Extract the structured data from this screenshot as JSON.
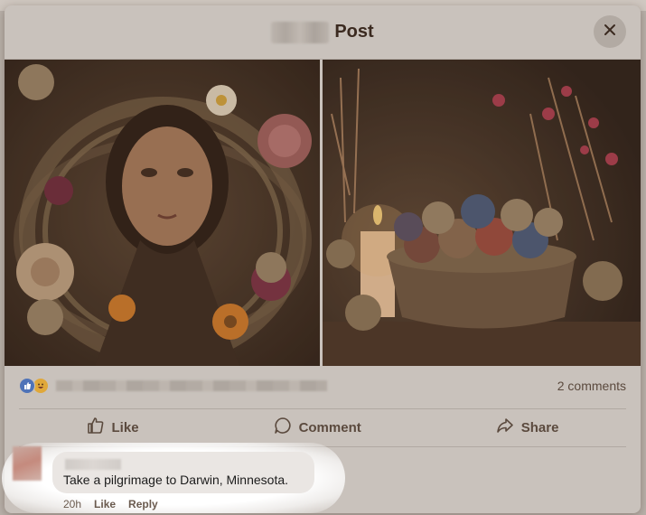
{
  "header": {
    "title": "Post",
    "close_icon": "close-icon"
  },
  "images": [
    {
      "alt_icon": "portrait-photo"
    },
    {
      "alt_icon": "still-life-photo"
    }
  ],
  "stats": {
    "comment_count": "2 comments"
  },
  "actions": {
    "like": "Like",
    "comment": "Comment",
    "share": "Share"
  },
  "comment": {
    "text": "Take a pilgrimage to Darwin, Minnesota.",
    "time": "20h",
    "like": "Like",
    "reply": "Reply"
  },
  "colors": {
    "dialog_bg": "#c9c2bc",
    "title": "#3b2a20",
    "like_reaction": "#4f73b8",
    "haha_reaction": "#e0a83a"
  }
}
